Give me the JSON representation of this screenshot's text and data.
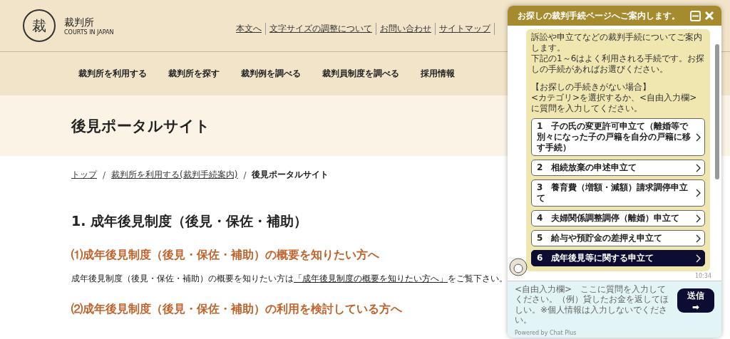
{
  "header": {
    "logo_mark": "裁",
    "site_name": "裁判所",
    "site_name_en": "COURTS IN JAPAN",
    "utility_links": [
      "本文へ",
      "文字サイズの調整について",
      "お問い合わせ",
      "サイトマップ"
    ]
  },
  "nav": [
    "裁判所を利用する",
    "裁判所を探す",
    "裁判例を調べる",
    "裁判員制度を調べる",
    "採用情報"
  ],
  "page_title": "後見ポータルサイト",
  "breadcrumb": [
    {
      "label": "トップ",
      "link": true
    },
    {
      "label": "裁判所を利用する(裁判手続案内)",
      "link": true
    },
    {
      "label": "後見ポータルサイト",
      "link": false
    }
  ],
  "breadcrumb_separator": "/",
  "content": {
    "heading": "1. 成年後見制度（後見・保佐・補助）",
    "sections": [
      {
        "heading": "⑴成年後見制度（後見・保佐・補助）の概要を知りたい方へ",
        "text_before": "成年後見制度（後見・保佐・補助）の概要を知りたい方は",
        "link": "「成年後見制度の概要を知りたい方へ」",
        "text_after": "をご覧下さい。"
      },
      {
        "heading": "⑵成年後見制度（後見・保佐・補助）の利用を検討している方へ"
      }
    ]
  },
  "chat": {
    "title": "お探しの裁判手続ページへご案内します。",
    "message": [
      {
        "lines": [
          "訴訟や申立てなどの裁判手続についてご案内します。",
          "下記の1～6はよく利用される手続です。お探しの手続があればお選びください。"
        ]
      },
      {
        "lines": [
          "【お探しの手続きがない場合】",
          "<カテゴリ>を選択するか、<自由入力欄>に質問を入力してください。"
        ]
      }
    ],
    "options": [
      {
        "label": "1　子の氏の変更許可申立て（離婚等で別々になった子の戸籍を自分の戸籍に移す手続）",
        "selected": false
      },
      {
        "label": "2　相続放棄の申述申立て",
        "selected": false
      },
      {
        "label": "3　養育費（増額・減額）請求調停申立て",
        "selected": false
      },
      {
        "label": "4　夫婦関係調整調停（離婚）申立て",
        "selected": false
      },
      {
        "label": "5　給与や預貯金の差押え申立て",
        "selected": false
      },
      {
        "label": "6　成年後見等に関する申立て",
        "selected": true
      }
    ],
    "time": "10:34",
    "input": {
      "placeholder": "<自由入力欄>　ここに質問を入力してください。（例）貸したお金を返してほしい。※個人情報は入力しないでください。"
    },
    "send": {
      "label": "送信",
      "arrow": "➡"
    },
    "footer": "Powered by Chat Plus"
  }
}
